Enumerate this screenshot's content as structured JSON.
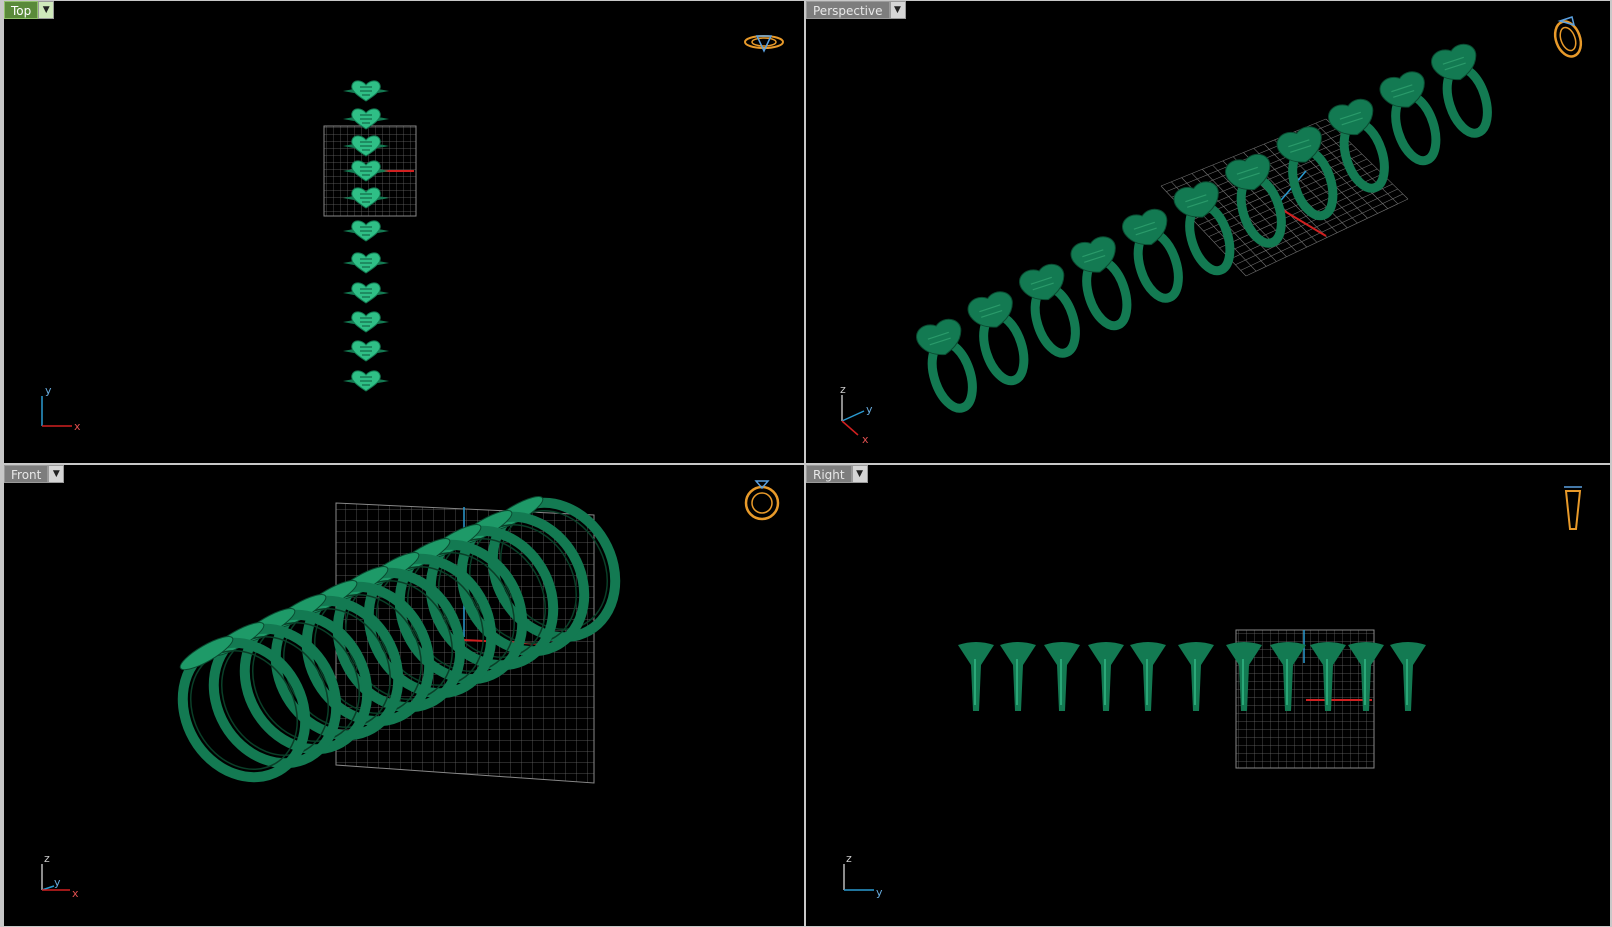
{
  "viewports": [
    {
      "id": "top",
      "label": "Top",
      "active": true,
      "axes": [
        "y",
        "x"
      ]
    },
    {
      "id": "perspective",
      "label": "Perspective",
      "active": false,
      "axes": [
        "z",
        "y",
        "x"
      ]
    },
    {
      "id": "front",
      "label": "Front",
      "active": false,
      "axes": [
        "z",
        "y",
        "x"
      ]
    },
    {
      "id": "right",
      "label": "Right",
      "active": false,
      "axes": [
        "z",
        "y"
      ]
    }
  ],
  "icons": {
    "dropdown": "chevron-down-icon",
    "nav": "ring-navigation-icon"
  },
  "colors": {
    "model": "#137a52",
    "model_light": "#2fbf86",
    "grid": "#6a6a6a",
    "axis_x": "#d12020",
    "axis_y": "#2a9ad0",
    "nav": "#e89a2a"
  }
}
